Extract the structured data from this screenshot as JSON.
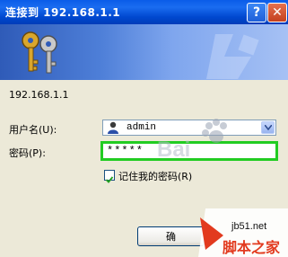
{
  "window": {
    "title": "连接到 192.168.1.1",
    "help_label": "?",
    "close_label": "✕"
  },
  "dialog": {
    "host": "192.168.1.1",
    "username_label": "用户名(U):",
    "username_value": "admin",
    "password_label": "密码(P):",
    "password_value": "*****",
    "remember_label": "记住我的密码(R)",
    "remember_checked": true,
    "ok_button_label": "确"
  },
  "watermark": {
    "site": "jb51.net",
    "brand": "脚本之家",
    "overlay": "Bai"
  },
  "colors": {
    "titlebar": "#0A5CE8",
    "focus_border": "#22CC22",
    "brand_red": "#E23A1E"
  }
}
